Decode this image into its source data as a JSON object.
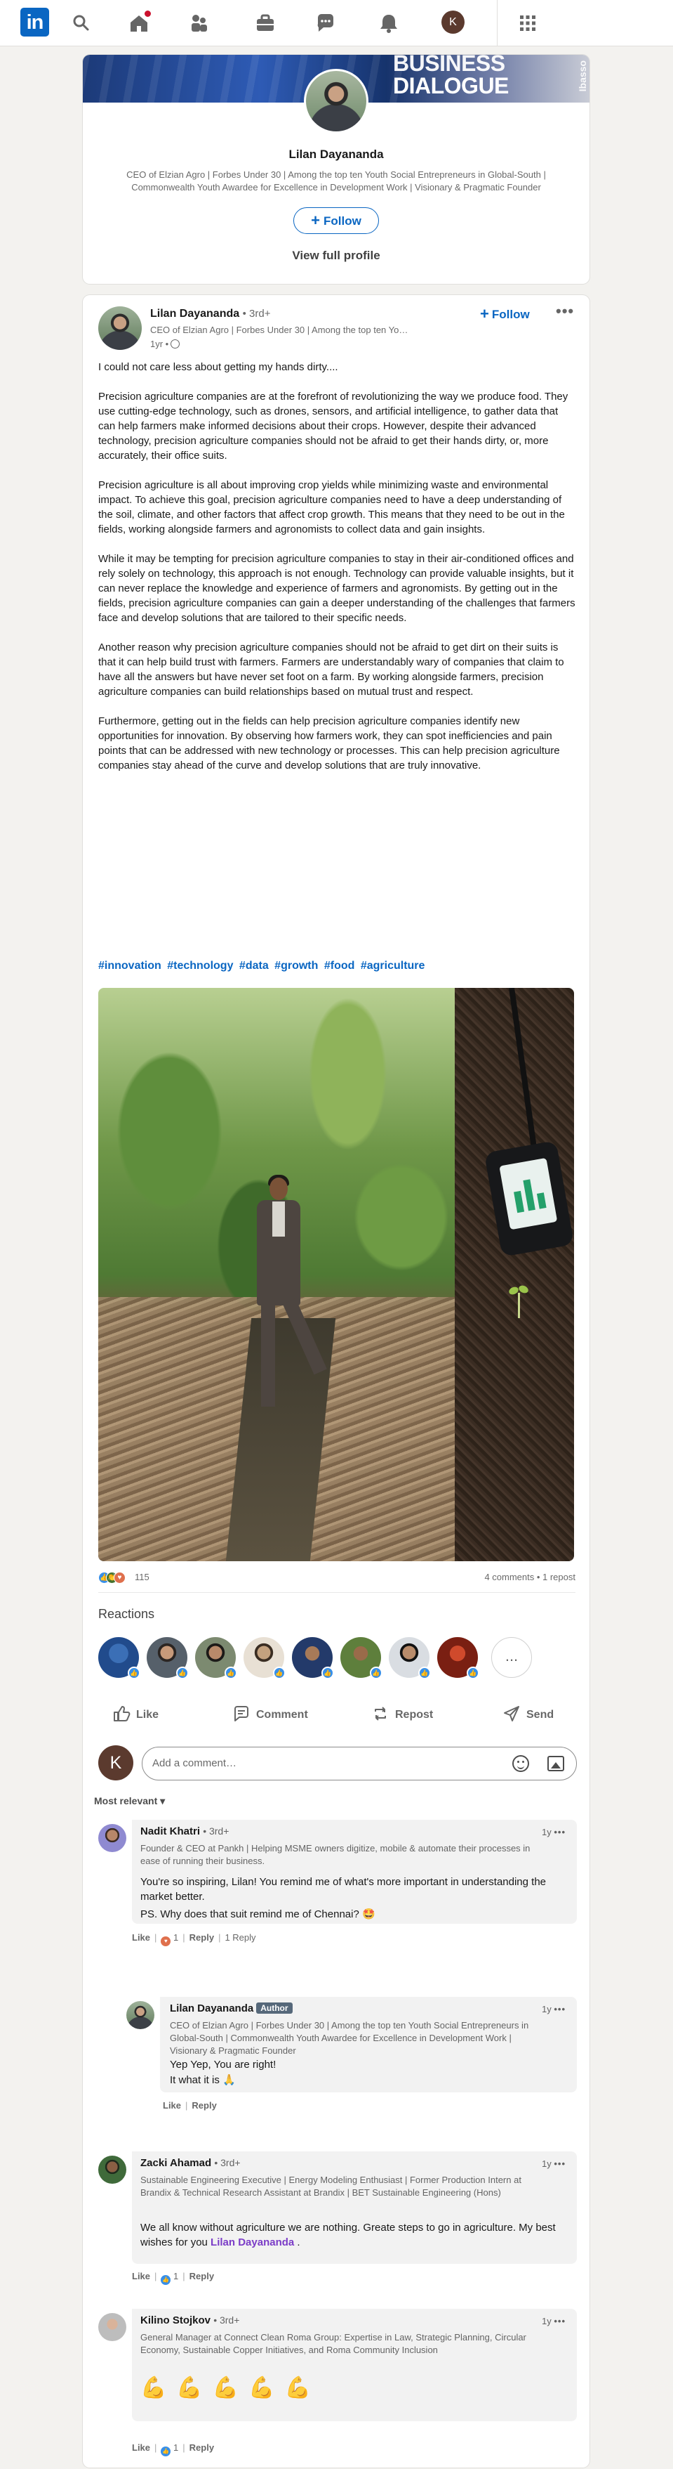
{
  "nav": {
    "logo": "in",
    "avatar_initial": "K",
    "icons": [
      "search-icon",
      "home-icon",
      "network-icon",
      "jobs-icon",
      "messaging-icon",
      "notifications-icon",
      "apps-grid-icon"
    ]
  },
  "profile_card": {
    "banner_line1": "BUSINESS",
    "banner_line2": "DIALOGUE",
    "banner_side": "Ibasso",
    "name": "Lilan Dayananda",
    "headline": "CEO of Elzian Agro | Forbes Under 30 | Among the top ten Youth Social Entrepreneurs in Global-South | Commonwealth Youth Awardee for Excellence in Development Work | Visionary & Pragmatic Founder",
    "follow_label": "Follow",
    "view_profile_label": "View full profile"
  },
  "post": {
    "author": "Lilan Dayananda",
    "degree": "• 3rd+",
    "author_headline": "CEO of Elzian Agro | Forbes Under 30 | Among the top ten Youth So...",
    "time": "1yr •",
    "follow_label": "Follow",
    "menu": "•••",
    "paragraphs": [
      "I could not care less about getting my hands dirty....",
      "Precision agriculture companies are at the forefront of revolutionizing the way we produce food. They use cutting-edge technology, such as drones, sensors, and artificial intelligence, to gather data that can help farmers make informed decisions about their crops. However, despite their advanced technology, precision agriculture companies should not be afraid to get their hands dirty, or, more accurately, their office suits.",
      "Precision agriculture is all about improving crop yields while minimizing waste and environmental impact. To achieve this goal, precision agriculture companies need to have a deep understanding of the soil, climate, and other factors that affect crop growth. This means that they need to be out in the fields, working alongside farmers and agronomists to collect data and gain insights.",
      "While it may be tempting for precision agriculture companies to stay in their air-conditioned offices and rely solely on technology, this approach is not enough. Technology can provide valuable insights, but it can never replace the knowledge and experience of farmers and agronomists. By getting out in the fields, precision agriculture companies can gain a deeper understanding of the challenges that farmers face and develop solutions that are tailored to their specific needs.",
      "Another reason why precision agriculture companies should not be afraid to get dirt on their suits is that it can help build trust with farmers. Farmers are understandably wary of companies that claim to have all the answers but have never set foot on a farm. By working alongside farmers, precision agriculture companies can build relationships based on mutual trust and respect.",
      "Furthermore, getting out in the fields can help precision agriculture companies identify new opportunities for innovation. By observing how farmers work, they can spot inefficiencies and pain points that can be addressed with new technology or processes. This can help precision agriculture companies stay ahead of the curve and develop solutions that are truly innovative."
    ],
    "hashtags": [
      "#innovation",
      "#technology",
      "#data",
      "#growth",
      "#food",
      "#agriculture"
    ],
    "reaction_count": "115",
    "comments_reposts": "4 comments • 1 repost",
    "reactions_title": "Reactions",
    "actions": {
      "like": "Like",
      "comment": "Comment",
      "repost": "Repost",
      "send": "Send"
    },
    "more_reactors": "..."
  },
  "composer": {
    "avatar_initial": "K",
    "placeholder": "Add a comment…"
  },
  "sort_label": "Most relevant",
  "comments": [
    {
      "name": "Nadit Khatri",
      "degree": "• 3rd+",
      "time": "1y",
      "headline": "Founder & CEO at Pankh | Helping MSME owners digitize, mobile & automate their processes in ease of running their business.",
      "text1": "You're so inspiring, Lilan! You remind me of what's more important in understanding the market better.",
      "text2": "PS. Why does that suit remind me of Chennai? 🤩",
      "like": "Like",
      "like_count": "1",
      "reply": "Reply",
      "reply_count": "1 Reply"
    },
    {
      "name": "Lilan Dayananda",
      "badge": "Author",
      "time": "1y",
      "headline": "CEO of Elzian Agro | Forbes Under 30 | Among the top ten Youth Social Entrepreneurs in Global-South | Commonwealth Youth Awardee for Excellence in Development Work | Visionary & Pragmatic Founder",
      "text1": "Yep Yep, You are right!",
      "text2": "It what it is 🙏",
      "like": "Like",
      "reply": "Reply"
    },
    {
      "name": "Zacki Ahamad",
      "degree": "• 3rd+",
      "time": "1y",
      "headline": "Sustainable Engineering Executive | Energy Modeling Enthusiast | Former Production Intern at Brandix & Technical Research Assistant at Brandix | BET Sustainable Engineering (Hons)",
      "text1": "We all know without agriculture we are nothing. Greate steps to go in agriculture. My best wishes for you ",
      "mention": "Lilan Dayananda",
      "text_tail": " .",
      "like": "Like",
      "like_count": "1",
      "reply": "Reply"
    },
    {
      "name": "Kilino Stojkov",
      "degree": "• 3rd+",
      "time": "1y",
      "headline": "General Manager at Connect Clean Roma Group: Expertise in Law, Strategic Planning, Circular Economy, Sustainable Copper Initiatives, and Roma Community Inclusion",
      "emojis": [
        "💪",
        "💪",
        "💪",
        "💪",
        "💪"
      ],
      "like": "Like",
      "like_count": "1",
      "reply": "Reply"
    }
  ],
  "colors": {
    "brand_blue": "#0a66c2",
    "background": "#f3f2ef",
    "notification_red": "#cb112d",
    "mention_purple": "#7b3cc7"
  }
}
